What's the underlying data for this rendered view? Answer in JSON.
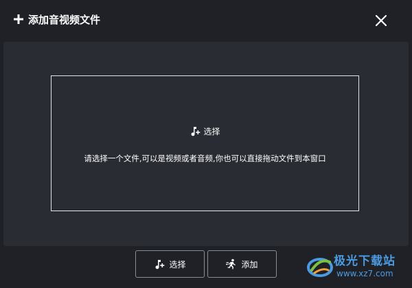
{
  "dialog": {
    "title": "添加音视频文件",
    "title_icon": "plus-icon",
    "close_icon": "close-icon"
  },
  "dropzone": {
    "select_label": "选择",
    "select_icon": "music-add-icon",
    "hint": "请选择一个文件,可以是视频或者音频,你也可以直接拖动文件到本窗口"
  },
  "footer": {
    "select_button_label": "选择",
    "select_button_icon": "music-add-icon",
    "add_button_label": "添加",
    "add_button_icon": "running-man-icon"
  },
  "watermark": {
    "name": "极光下载站",
    "url": "www.xz7.com"
  },
  "colors": {
    "background": "#1f2127",
    "panel": "#292c33",
    "border": "#e6e6e6",
    "watermark": "#4b9be3"
  }
}
